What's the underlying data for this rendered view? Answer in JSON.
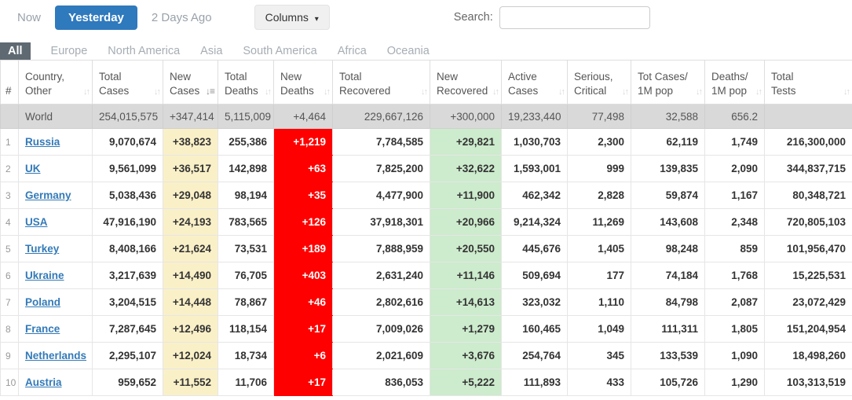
{
  "toolbar": {
    "now_label": "Now",
    "yesterday_label": "Yesterday",
    "two_days_ago_label": "2 Days Ago",
    "columns_label": "Columns",
    "search_label": "Search:",
    "search_value": ""
  },
  "tabs": [
    "All",
    "Europe",
    "North America",
    "Asia",
    "South America",
    "Africa",
    "Oceania"
  ],
  "active_tab": "All",
  "colors": {
    "accent_blue": "#2f79bd",
    "active_tab_gray": "#5f6972",
    "link_blue": "#337ab7",
    "highlight_yellow": "#faf0c8",
    "highlight_red": "#fe0000",
    "highlight_green": "#cdebcd",
    "world_row_gray": "#d9d9d9"
  },
  "table": {
    "columns": [
      {
        "key": "rank",
        "label": "#",
        "sort": "none"
      },
      {
        "key": "country",
        "label": "Country,\nOther",
        "sort": "unsorted"
      },
      {
        "key": "total_cases",
        "label": "Total\nCases",
        "sort": "unsorted"
      },
      {
        "key": "new_cases",
        "label": "New\nCases",
        "sort": "desc"
      },
      {
        "key": "total_deaths",
        "label": "Total\nDeaths",
        "sort": "unsorted"
      },
      {
        "key": "new_deaths",
        "label": "New\nDeaths",
        "sort": "unsorted"
      },
      {
        "key": "total_recovered",
        "label": "Total\nRecovered",
        "sort": "unsorted"
      },
      {
        "key": "new_recovered",
        "label": "New\nRecovered",
        "sort": "unsorted"
      },
      {
        "key": "active_cases",
        "label": "Active\nCases",
        "sort": "unsorted"
      },
      {
        "key": "serious_critical",
        "label": "Serious,\nCritical",
        "sort": "unsorted"
      },
      {
        "key": "tot_cases_1m",
        "label": "Tot Cases/\n1M pop",
        "sort": "unsorted"
      },
      {
        "key": "deaths_1m",
        "label": "Deaths/\n1M pop",
        "sort": "unsorted"
      },
      {
        "key": "total_tests",
        "label": "Total\nTests",
        "sort": "unsorted"
      }
    ],
    "world_row": {
      "rank": "",
      "country": "World",
      "total_cases": "254,015,575",
      "new_cases": "+347,414",
      "total_deaths": "5,115,009",
      "new_deaths": "+4,464",
      "total_recovered": "229,667,126",
      "new_recovered": "+300,000",
      "active_cases": "19,233,440",
      "serious_critical": "77,498",
      "tot_cases_1m": "32,588",
      "deaths_1m": "656.2",
      "total_tests": ""
    },
    "rows": [
      {
        "rank": "1",
        "country": "Russia",
        "total_cases": "9,070,674",
        "new_cases": "+38,823",
        "total_deaths": "255,386",
        "new_deaths": "+1,219",
        "total_recovered": "7,784,585",
        "new_recovered": "+29,821",
        "active_cases": "1,030,703",
        "serious_critical": "2,300",
        "tot_cases_1m": "62,119",
        "deaths_1m": "1,749",
        "total_tests": "216,300,000"
      },
      {
        "rank": "2",
        "country": "UK",
        "total_cases": "9,561,099",
        "new_cases": "+36,517",
        "total_deaths": "142,898",
        "new_deaths": "+63",
        "total_recovered": "7,825,200",
        "new_recovered": "+32,622",
        "active_cases": "1,593,001",
        "serious_critical": "999",
        "tot_cases_1m": "139,835",
        "deaths_1m": "2,090",
        "total_tests": "344,837,715"
      },
      {
        "rank": "3",
        "country": "Germany",
        "total_cases": "5,038,436",
        "new_cases": "+29,048",
        "total_deaths": "98,194",
        "new_deaths": "+35",
        "total_recovered": "4,477,900",
        "new_recovered": "+11,900",
        "active_cases": "462,342",
        "serious_critical": "2,828",
        "tot_cases_1m": "59,874",
        "deaths_1m": "1,167",
        "total_tests": "80,348,721"
      },
      {
        "rank": "4",
        "country": "USA",
        "total_cases": "47,916,190",
        "new_cases": "+24,193",
        "total_deaths": "783,565",
        "new_deaths": "+126",
        "total_recovered": "37,918,301",
        "new_recovered": "+20,966",
        "active_cases": "9,214,324",
        "serious_critical": "11,269",
        "tot_cases_1m": "143,608",
        "deaths_1m": "2,348",
        "total_tests": "720,805,103"
      },
      {
        "rank": "5",
        "country": "Turkey",
        "total_cases": "8,408,166",
        "new_cases": "+21,624",
        "total_deaths": "73,531",
        "new_deaths": "+189",
        "total_recovered": "7,888,959",
        "new_recovered": "+20,550",
        "active_cases": "445,676",
        "serious_critical": "1,405",
        "tot_cases_1m": "98,248",
        "deaths_1m": "859",
        "total_tests": "101,956,470"
      },
      {
        "rank": "6",
        "country": "Ukraine",
        "total_cases": "3,217,639",
        "new_cases": "+14,490",
        "total_deaths": "76,705",
        "new_deaths": "+403",
        "total_recovered": "2,631,240",
        "new_recovered": "+11,146",
        "active_cases": "509,694",
        "serious_critical": "177",
        "tot_cases_1m": "74,184",
        "deaths_1m": "1,768",
        "total_tests": "15,225,531"
      },
      {
        "rank": "7",
        "country": "Poland",
        "total_cases": "3,204,515",
        "new_cases": "+14,448",
        "total_deaths": "78,867",
        "new_deaths": "+46",
        "total_recovered": "2,802,616",
        "new_recovered": "+14,613",
        "active_cases": "323,032",
        "serious_critical": "1,110",
        "tot_cases_1m": "84,798",
        "deaths_1m": "2,087",
        "total_tests": "23,072,429"
      },
      {
        "rank": "8",
        "country": "France",
        "total_cases": "7,287,645",
        "new_cases": "+12,496",
        "total_deaths": "118,154",
        "new_deaths": "+17",
        "total_recovered": "7,009,026",
        "new_recovered": "+1,279",
        "active_cases": "160,465",
        "serious_critical": "1,049",
        "tot_cases_1m": "111,311",
        "deaths_1m": "1,805",
        "total_tests": "151,204,954"
      },
      {
        "rank": "9",
        "country": "Netherlands",
        "total_cases": "2,295,107",
        "new_cases": "+12,024",
        "total_deaths": "18,734",
        "new_deaths": "+6",
        "total_recovered": "2,021,609",
        "new_recovered": "+3,676",
        "active_cases": "254,764",
        "serious_critical": "345",
        "tot_cases_1m": "133,539",
        "deaths_1m": "1,090",
        "total_tests": "18,498,260"
      },
      {
        "rank": "10",
        "country": "Austria",
        "total_cases": "959,652",
        "new_cases": "+11,552",
        "total_deaths": "11,706",
        "new_deaths": "+17",
        "total_recovered": "836,053",
        "new_recovered": "+5,222",
        "active_cases": "111,893",
        "serious_critical": "433",
        "tot_cases_1m": "105,726",
        "deaths_1m": "1,290",
        "total_tests": "103,313,519"
      }
    ]
  }
}
